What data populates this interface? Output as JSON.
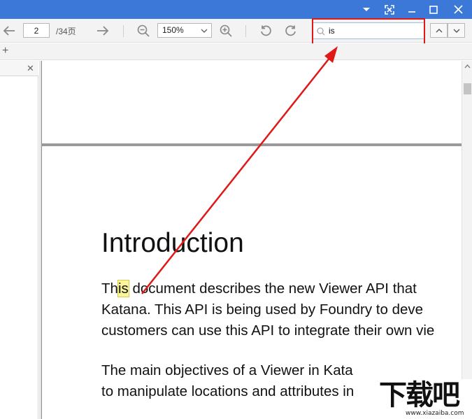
{
  "toolbar": {
    "page_current": "2",
    "page_total": "/34页",
    "zoom": "150%",
    "search_value": "is"
  },
  "document": {
    "title": "Introduction",
    "para1": [
      {
        "before": "Th",
        "hl": "is",
        "after": " document describes the new Viewer API that"
      },
      {
        "text": "Katana. This API is being used by Foundry to deve"
      },
      {
        "text": "customers can use this API to integrate their own vie"
      }
    ],
    "para2": [
      "The main objectives of a Viewer in Kata",
      "to manipulate locations and attributes in"
    ]
  },
  "watermark": {
    "logo_text": "下载吧",
    "url": "www.xiazaiba.com"
  },
  "colors": {
    "titlebar": "#3c78d8",
    "annotation": "#e01818",
    "search_highlight": "#fcf59a"
  }
}
